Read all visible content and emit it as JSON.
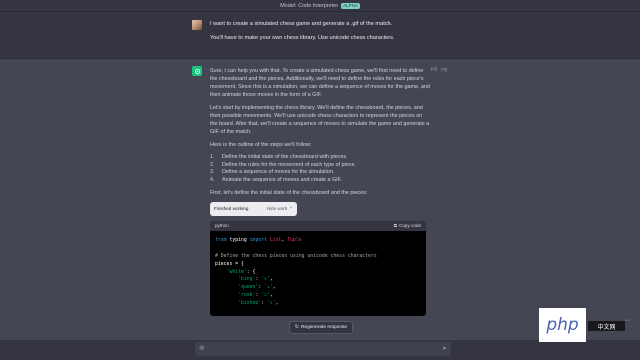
{
  "topbar": {
    "model_label": "Model: Code Interpreter",
    "badge": "ALPHA"
  },
  "user": {
    "line1": "I want to create a simulated chess game and generate a .gif of the match.",
    "line2": "You'll have to make your own chess library. Use unicode chess characters."
  },
  "assistant": {
    "p1": "Sure, I can help you with that. To create a simulated chess game, we'll first need to define the chessboard and the pieces. Additionally, we'll need to define the rules for each piece's movement. Since this is a simulation, we can define a sequence of moves for the game, and then animate those moves in the form of a GIF.",
    "p2": "Let's start by implementing the chess library. We'll define the chessboard, the pieces, and their possible movements. We'll use unicode chess characters to represent the pieces on the board. After that, we'll create a sequence of moves to simulate the game and generate a GIF of the match.",
    "p3": "Here is the outline of the steps we'll follow:",
    "steps": [
      {
        "num": "1.",
        "text": "Define the initial state of the chessboard with pieces."
      },
      {
        "num": "2.",
        "text": "Define the rules for the movement of each type of piece."
      },
      {
        "num": "3.",
        "text": "Define a sequence of moves for the simulation."
      },
      {
        "num": "4.",
        "text": "Animate the sequence of moves and create a GIF."
      }
    ],
    "p4": "First, let's define the initial state of the chessboard and the pieces:",
    "work_status": "Finished working",
    "hide_work": "Hide work"
  },
  "code": {
    "language": "python",
    "copy_label": "Copy code",
    "line1_kw1": "from",
    "line1_mod": " typing ",
    "line1_kw2": "import",
    "line1_a": " List",
    "line1_comma": ", ",
    "line1_b": "Tuple",
    "line3": "# Define the chess pieces using unicode chess characters",
    "line4": "pieces = {",
    "line5_key": "'white'",
    "line5_rest": ": {",
    "line6_key": "'king'",
    "line6_val": "'♔'",
    "line7_key": "'queen'",
    "line7_val": "'♕'",
    "line8_key": "'rook'",
    "line8_val": "'♖'",
    "line9_key": "'bishop'",
    "line9_val": "'♗'"
  },
  "regenerate_label": "Regenerate response",
  "watermark": {
    "logo_text": "php",
    "bar_text": "中文网"
  }
}
